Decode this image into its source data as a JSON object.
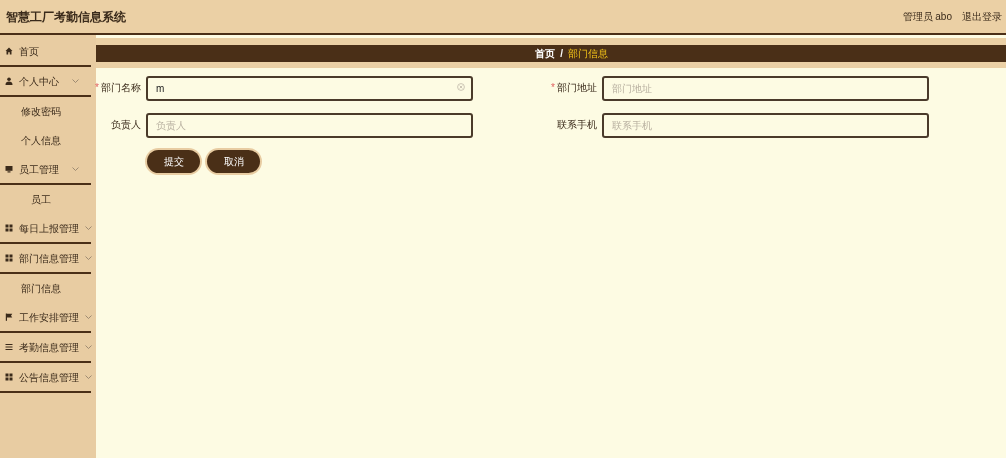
{
  "header": {
    "title": "智慧工厂考勤信息系统",
    "user": "管理员 abo",
    "logout": "退出登录"
  },
  "sidebar": {
    "items": [
      {
        "kind": "menu",
        "label": "首页",
        "chevron": false
      },
      {
        "kind": "menu",
        "label": "个人中心",
        "chevron": true
      },
      {
        "kind": "sub",
        "label": "修改密码"
      },
      {
        "kind": "sub",
        "label": "个人信息"
      },
      {
        "kind": "menu",
        "label": "员工管理",
        "chevron": true
      },
      {
        "kind": "sub",
        "label": "员工"
      },
      {
        "kind": "menu",
        "label": "每日上报管理",
        "chevron": true
      },
      {
        "kind": "menu",
        "label": "部门信息管理",
        "chevron": true
      },
      {
        "kind": "sub",
        "label": "部门信息"
      },
      {
        "kind": "menu",
        "label": "工作安排管理",
        "chevron": true
      },
      {
        "kind": "menu",
        "label": "考勤信息管理",
        "chevron": true
      },
      {
        "kind": "menu",
        "label": "公告信息管理",
        "chevron": true
      }
    ]
  },
  "breadcrumb": [
    {
      "label": "首页",
      "selected": false
    },
    {
      "label": "部门信息",
      "selected": true
    }
  ],
  "breadcrumb_separator": "/",
  "form": {
    "fields": [
      {
        "label": "部门名称",
        "required": true,
        "value": "m",
        "clearable": true
      },
      {
        "label": "部门地址",
        "required": true,
        "placeholder": "部门地址",
        "clearable": false
      },
      {
        "label": "负责人",
        "required": false,
        "placeholder": "负责人",
        "clearable": false
      },
      {
        "label": "联系手机",
        "required": false,
        "placeholder": "联系手机",
        "clearable": false
      }
    ],
    "required_mark": "*",
    "buttons": [
      "提交",
      "取消"
    ]
  }
}
